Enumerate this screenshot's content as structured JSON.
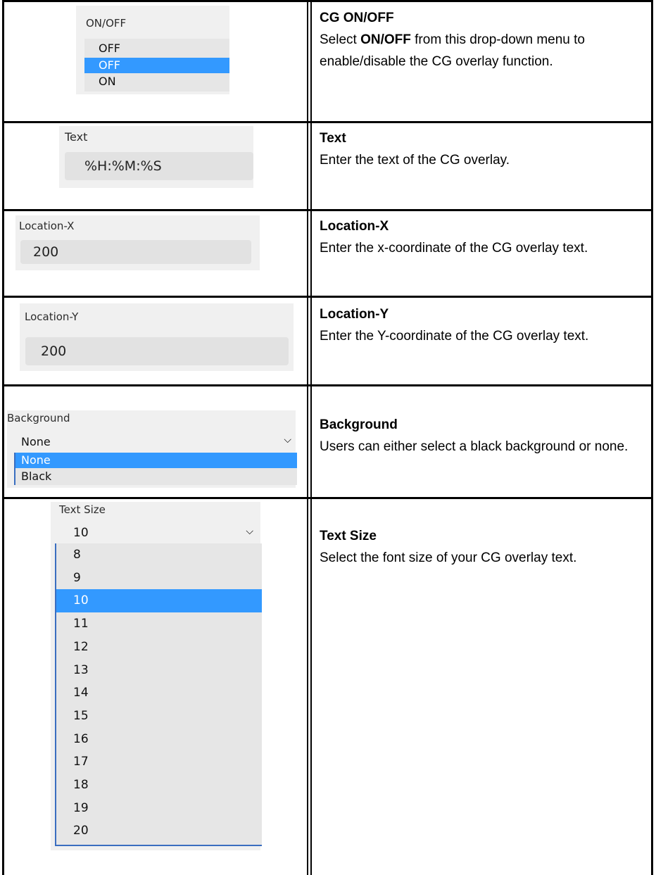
{
  "rows": [
    {
      "ui": {
        "label": "ON/OFF",
        "options": [
          "OFF",
          "OFF",
          "ON"
        ],
        "selected_index": 1
      },
      "title": "CG ON/OFF",
      "desc_parts": [
        "Select ",
        "ON",
        "/",
        "OFF",
        " from this drop-down menu to enable/disable the CG overlay function."
      ]
    },
    {
      "ui": {
        "label": "Text",
        "value": "%H:%M:%S"
      },
      "title": "Text",
      "desc": "Enter the text of the CG overlay."
    },
    {
      "ui": {
        "label": "Location-X",
        "value": "200"
      },
      "title": "Location-X",
      "desc": "Enter the x-coordinate of the CG overlay text."
    },
    {
      "ui": {
        "label": "Location-Y",
        "value": "200"
      },
      "title": "Location-Y",
      "desc": "Enter the Y-coordinate of the CG overlay text."
    },
    {
      "ui": {
        "label": "Background",
        "value": "None",
        "options": [
          "None",
          "Black"
        ],
        "selected_index": 0
      },
      "title": "Background",
      "desc": "Users can either select a black background or none."
    },
    {
      "ui": {
        "label": "Text Size",
        "value": "10",
        "options": [
          "8",
          "9",
          "10",
          "11",
          "12",
          "13",
          "14",
          "15",
          "16",
          "17",
          "18",
          "19",
          "20"
        ],
        "selected_index": 2
      },
      "title": "Text Size",
      "desc": "Select the font size of your CG overlay text."
    }
  ],
  "colors": {
    "selection": "#3399ff",
    "panel_bg": "#f0f0f0",
    "field_bg": "#e2e2e2"
  },
  "icons": {
    "dropdown": "chevron-down-icon"
  }
}
